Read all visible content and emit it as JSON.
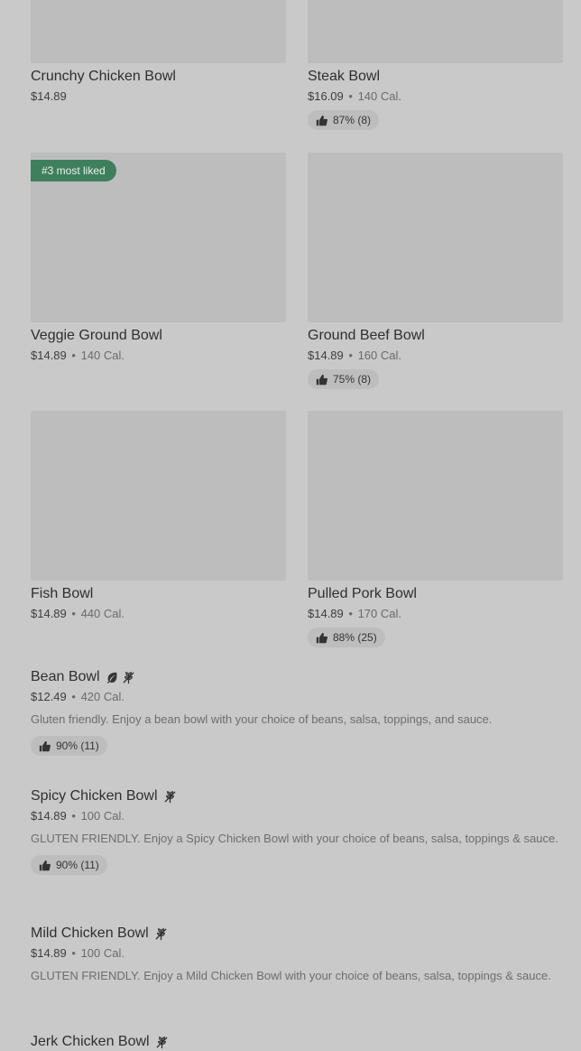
{
  "grid": [
    {
      "name": "Crunchy Chicken Bowl",
      "price": "$14.89",
      "calories": "",
      "rating": "",
      "badge": ""
    },
    {
      "name": "Steak Bowl",
      "price": "$16.09",
      "calories": "140 Cal.",
      "rating": "87% (8)",
      "badge": ""
    },
    {
      "name": "Veggie Ground Bowl",
      "price": "$14.89",
      "calories": "140 Cal.",
      "rating": "",
      "badge": "#3 most liked"
    },
    {
      "name": "Ground Beef Bowl",
      "price": "$14.89",
      "calories": "160 Cal.",
      "rating": "75% (8)",
      "badge": ""
    },
    {
      "name": "Fish Bowl",
      "price": "$14.89",
      "calories": "440 Cal.",
      "rating": "",
      "badge": ""
    },
    {
      "name": "Pulled Pork Bowl",
      "price": "$14.89",
      "calories": "170 Cal.",
      "rating": "88% (25)",
      "badge": ""
    }
  ],
  "list": [
    {
      "name": "Bean Bowl",
      "price": "$12.49",
      "calories": "420 Cal.",
      "desc": "Gluten friendly. Enjoy a bean bowl with your choice of beans, salsa, toppings, and sauce.",
      "rating": "90% (11)",
      "icons": [
        "leaf-icon",
        "wheat-free-icon"
      ]
    },
    {
      "name": "Spicy Chicken Bowl",
      "price": "$14.89",
      "calories": "100 Cal.",
      "desc": "GLUTEN FRIENDLY. Enjoy a Spicy Chicken Bowl with your choice of beans, salsa, toppings & sauce.",
      "rating": "90% (11)",
      "icons": [
        "wheat-free-icon"
      ]
    },
    {
      "name": "Mild Chicken Bowl",
      "price": "$14.89",
      "calories": "100 Cal.",
      "desc": "GLUTEN FRIENDLY. Enjoy a Mild Chicken Bowl with your choice of beans, salsa, toppings & sauce.",
      "rating": "",
      "icons": [
        "wheat-free-icon"
      ]
    },
    {
      "name": "Jerk Chicken Bowl",
      "price": "",
      "calories": "",
      "desc": "",
      "rating": "",
      "icons": [
        "wheat-free-icon"
      ]
    }
  ],
  "separator": "•",
  "colors": {
    "background": "#c9c9c9",
    "placeholder": "#bdbdbd",
    "badge": "#3f7f5e"
  }
}
